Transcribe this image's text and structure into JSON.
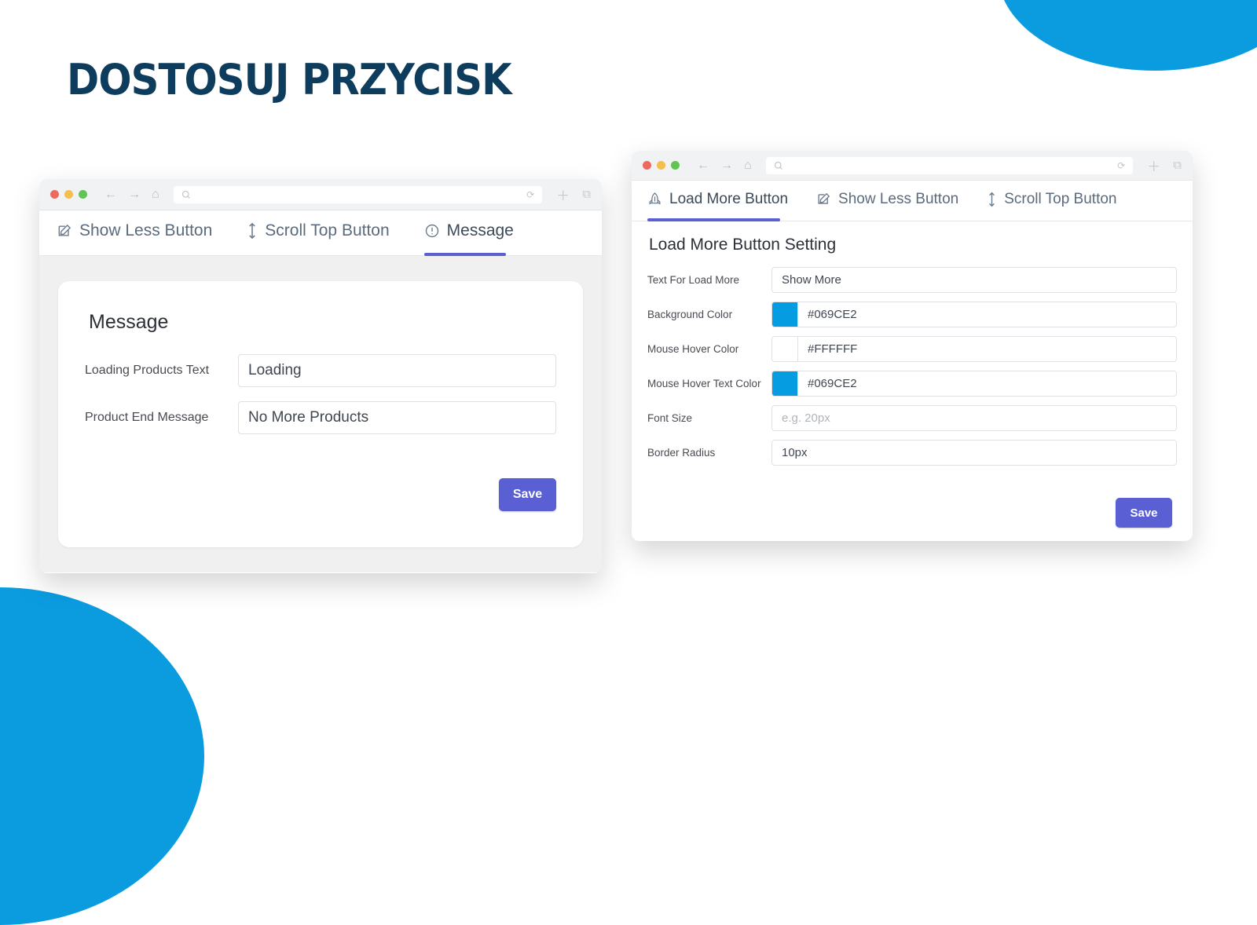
{
  "page": {
    "title": "DOSTOSUJ PRZYCISK",
    "accent_blue": "#069CE2",
    "title_color": "#0D3C5C",
    "save_button_color": "#5A5FD4"
  },
  "left_window": {
    "chrome": {
      "back_icon": "back-arrow-icon",
      "forward_icon": "forward-arrow-icon",
      "home_icon": "home-icon",
      "search_icon": "search-icon",
      "url_value": "",
      "reload_icon": "reload-icon",
      "new_tab_icon": "plus-icon",
      "tabs_icon": "duplicate-icon"
    },
    "tabs": [
      {
        "label": "Show Less Button",
        "icon": "pencil-square-icon",
        "active": false
      },
      {
        "label": "Scroll Top Button",
        "icon": "arrows-up-down-icon",
        "active": false
      },
      {
        "label": "Message",
        "icon": "exclamation-circle-icon",
        "active": true
      }
    ],
    "card": {
      "heading": "Message",
      "fields": [
        {
          "label": "Loading Products Text",
          "value": "Loading",
          "placeholder": ""
        },
        {
          "label": "Product End Message",
          "value": "No More Products",
          "placeholder": ""
        }
      ],
      "save_label": "Save"
    }
  },
  "right_window": {
    "chrome": {
      "back_icon": "back-arrow-icon",
      "forward_icon": "forward-arrow-icon",
      "home_icon": "home-icon",
      "search_icon": "search-icon",
      "url_value": "",
      "reload_icon": "reload-icon",
      "new_tab_icon": "plus-icon",
      "tabs_icon": "duplicate-icon"
    },
    "tabs": [
      {
        "label": "Load More Button",
        "icon": "rocket-icon",
        "active": true
      },
      {
        "label": "Show Less Button",
        "icon": "pencil-square-icon",
        "active": false
      },
      {
        "label": "Scroll Top Button",
        "icon": "arrows-up-down-icon",
        "active": false
      }
    ],
    "card": {
      "heading": "Load More Button Setting",
      "fields": [
        {
          "label": "Text For Load More",
          "value": "Show More",
          "placeholder": "",
          "swatch": null
        },
        {
          "label": "Background Color",
          "value": "#069CE2",
          "placeholder": "",
          "swatch": "#069CE2"
        },
        {
          "label": "Mouse Hover Color",
          "value": "#FFFFFF",
          "placeholder": "",
          "swatch": "#FFFFFF"
        },
        {
          "label": "Mouse Hover Text Color",
          "value": "#069CE2",
          "placeholder": "",
          "swatch": "#069CE2"
        },
        {
          "label": "Font Size",
          "value": "",
          "placeholder": "e.g. 20px",
          "swatch": null
        },
        {
          "label": "Border Radius",
          "value": "10px",
          "placeholder": "",
          "swatch": null
        }
      ],
      "save_label": "Save"
    }
  }
}
